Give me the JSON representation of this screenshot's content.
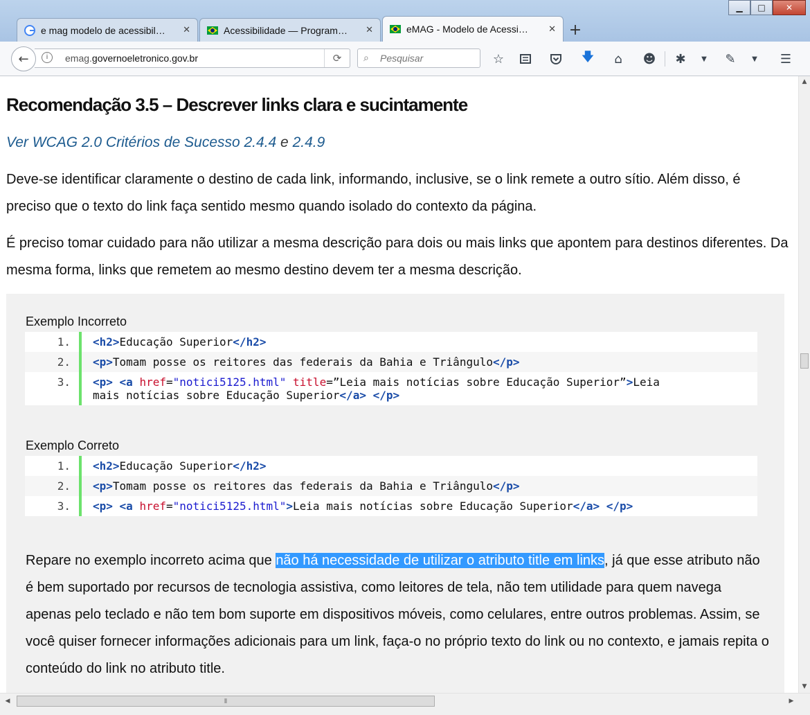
{
  "browser": {
    "tabs": [
      {
        "title": "e mag modelo de acessibil…",
        "icon": "google-icon"
      },
      {
        "title": "Acessibilidade — Program…",
        "icon": "brazil-flag-icon"
      },
      {
        "title": "eMAG - Modelo de Acessi…",
        "icon": "brazil-flag-icon",
        "active": true
      }
    ],
    "new_tab": "+",
    "url_domain_prefix": "emag.",
    "url_domain": "governoeletronico.gov.br",
    "search_placeholder": "Pesquisar"
  },
  "page": {
    "heading": "Recomendação 3.5 – Descrever links clara e sucintamente",
    "wcag_link_1": "Ver WCAG 2.0 Critérios de Sucesso 2.4.4",
    "wcag_conj": " e ",
    "wcag_link_2": "2.4.9",
    "paragraph_1": "Deve-se identificar claramente o destino de cada link, informando, inclusive, se o link remete a outro sítio. Além disso, é preciso que o texto do link faça sentido mesmo quando isolado do contexto da página.",
    "paragraph_2": "É preciso tomar cuidado para não utilizar a mesma descrição para dois ou mais links que apontem para destinos diferentes. Da mesma forma, links que remetem ao mesmo destino devem ter a mesma descrição.",
    "example_incorrect": {
      "label": "Exemplo Incorreto",
      "lines": [
        {
          "num": "1.",
          "tag_open": "<h2>",
          "text": "Educação Superior",
          "tag_close": "</h2>"
        },
        {
          "num": "2.",
          "tag_open": "<p>",
          "text": "Tomam posse os reitores das federais da Bahia e Triângulo",
          "tag_close": "</p>"
        },
        {
          "num": "3.",
          "p_open": "<p>",
          "a_open": "<a",
          "attr1": "href",
          "val1": "\"notici5125.html\"",
          "attr2": "title",
          "val2": "=”Leia mais notícias sobre Educação Superior”",
          "gt": ">",
          "link_text": "Leia mais notícias sobre Educação Superior",
          "a_close": "</a>",
          "p_close": "</p>"
        }
      ]
    },
    "example_correct": {
      "label": "Exemplo Correto",
      "lines": [
        {
          "num": "1.",
          "tag_open": "<h2>",
          "text": "Educação Superior",
          "tag_close": "</h2>"
        },
        {
          "num": "2.",
          "tag_open": "<p>",
          "text": "Tomam posse os reitores das federais da Bahia e Triângulo",
          "tag_close": "</p>"
        },
        {
          "num": "3.",
          "p_open": "<p>",
          "a_open": "<a",
          "attr1": "href",
          "val1": "\"notici5125.html\"",
          "gt": ">",
          "link_text": "Leia mais notícias sobre Educação Superior",
          "a_close": "</a>",
          "p_close": "</p>"
        }
      ]
    },
    "note_before": "Repare no exemplo incorreto acima que ",
    "note_highlight": "não há necessidade de utilizar o atributo title em links",
    "note_after": ", já que esse atributo não é bem suportado por recursos de tecnologia assistiva, como leitores de tela, não tem utilidade para quem navega apenas pelo teclado e não tem bom suporte em dispositivos móveis, como celulares, entre outros problemas. Assim, se você quiser fornecer informações adicionais para um link, faça-o no próprio texto do link ou no contexto, e jamais repita o conteúdo do link no atributo title."
  },
  "colors": {
    "link": "#1d5b8f",
    "selection": "#3399ff",
    "code_gutter": "#6ce26c",
    "code_tag": "#1a4ca8",
    "code_attr": "#c8102e",
    "code_value": "#1a1acf"
  }
}
